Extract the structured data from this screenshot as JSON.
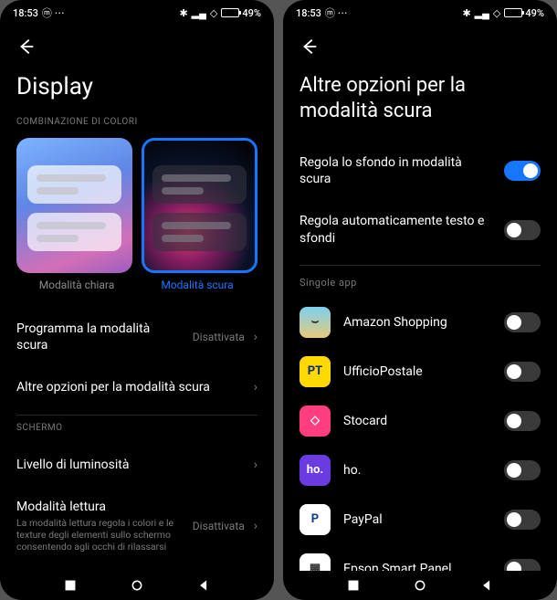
{
  "status": {
    "time": "18:53",
    "battery_pct": "49%"
  },
  "left": {
    "title": "Display",
    "section_colors": "COMBINAZIONE DI COLORI",
    "theme_light": "Modalità chiara",
    "theme_dark": "Modalità scura",
    "schedule_label": "Programma la modalità scura",
    "schedule_value": "Disattivata",
    "more_options": "Altre opzioni per la modalità scura",
    "section_screen": "SCHERMO",
    "brightness": "Livello di luminosità",
    "reading_mode_title": "Modalità lettura",
    "reading_mode_sub": "La modalità lettura regola i colori e le texture degli elementi sullo schermo consentendo agli occhi di rilassarsi",
    "reading_mode_value": "Disattivata"
  },
  "right": {
    "title": "Altre opzioni per la modalità scura",
    "row1": "Regola lo sfondo in modalità scura",
    "row1_on": true,
    "row2": "Regola automaticamente testo e sfondi",
    "row2_on": false,
    "section_apps": "Singole app",
    "apps": [
      {
        "name": "Amazon Shopping",
        "on": false,
        "bg": "linear-gradient(180deg,#7cd1f0,#e8c97a)",
        "glyph": "⌣",
        "fg": "#222"
      },
      {
        "name": "UfficioPostale",
        "on": false,
        "bg": "#ffd900",
        "glyph": "PT",
        "fg": "#0a2b7a"
      },
      {
        "name": "Stocard",
        "on": false,
        "bg": "#ff3d7f",
        "glyph": "◇",
        "fg": "#fff"
      },
      {
        "name": "ho.",
        "on": false,
        "bg": "#6a3be0",
        "glyph": "ho.",
        "fg": "#fff"
      },
      {
        "name": "PayPal",
        "on": false,
        "bg": "#fff",
        "glyph": "P",
        "fg": "#0a3d91"
      },
      {
        "name": "Epson Smart Panel",
        "on": false,
        "bg": "#fff",
        "glyph": "▦",
        "fg": "#333"
      }
    ]
  }
}
